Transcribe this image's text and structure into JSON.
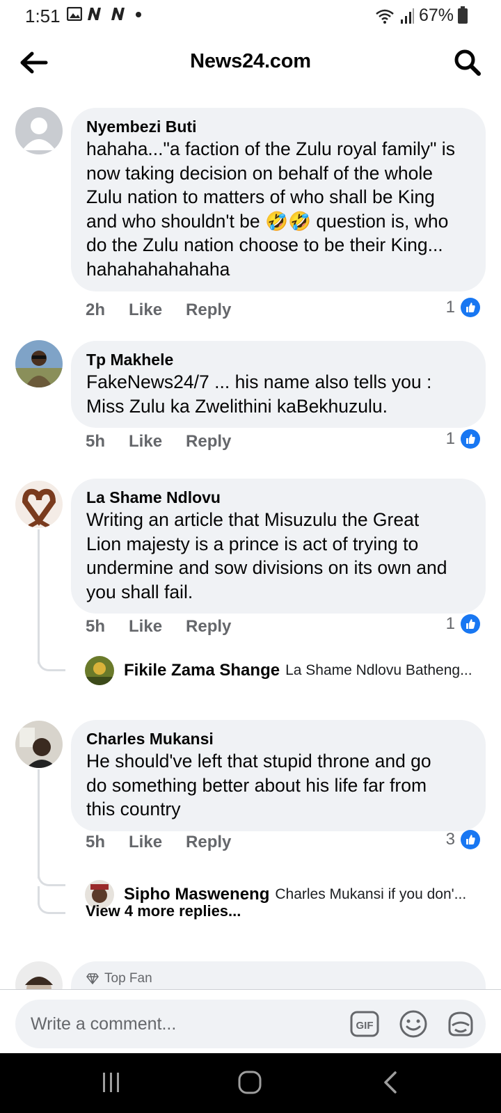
{
  "status": {
    "time": "1:51",
    "battery": "67%"
  },
  "header": {
    "title": "News24.com"
  },
  "comments": [
    {
      "author": "Nyembezi Buti",
      "text_lines": [
        "hahaha...\"a faction of the Zulu royal family\" is",
        "now taking decision on behalf of the whole",
        "Zulu nation to matters of who shall be King",
        "and who shouldn't be 🤣🤣 question is, who",
        "do the Zulu nation choose to be their King...",
        "hahahahahahaha"
      ],
      "time": "2h",
      "like": "Like",
      "reply": "Reply",
      "likes": "1"
    },
    {
      "author": "Tp Makhele",
      "text_lines": [
        "FakeNews24/7 ... his name also tells you :",
        "Miss Zulu ka Zwelithini kaBekhuzulu."
      ],
      "time": "5h",
      "like": "Like",
      "reply": "Reply",
      "likes": "1"
    },
    {
      "author": "La Shame Ndlovu",
      "text_lines": [
        "Writing an article that Misuzulu the Great",
        "Lion majesty is a prince is act of trying to",
        "undermine and sow divisions on its own and",
        "you shall fail."
      ],
      "time": "5h",
      "like": "Like",
      "reply": "Reply",
      "likes": "1",
      "reply_preview": {
        "author": "Fikile Zama Shange",
        "snippet": "La Shame Ndlovu Batheng..."
      }
    },
    {
      "author": "Charles Mukansi",
      "text_lines": [
        "He should've left that stupid throne and go",
        "do something better about his life far from",
        "this country"
      ],
      "time": "5h",
      "like": "Like",
      "reply": "Reply",
      "likes": "3",
      "reply_preview": {
        "author": "Sipho Masweneng",
        "snippet": "Charles Mukansi if you don'..."
      },
      "view_more": "View 4 more replies..."
    }
  ],
  "partial_comment": {
    "badge": "Top Fan"
  },
  "composer": {
    "placeholder": "Write a comment..."
  },
  "colors": {
    "like_blue": "#1877f2",
    "bubble_bg": "#f0f2f5",
    "meta_gray": "#65676b"
  }
}
